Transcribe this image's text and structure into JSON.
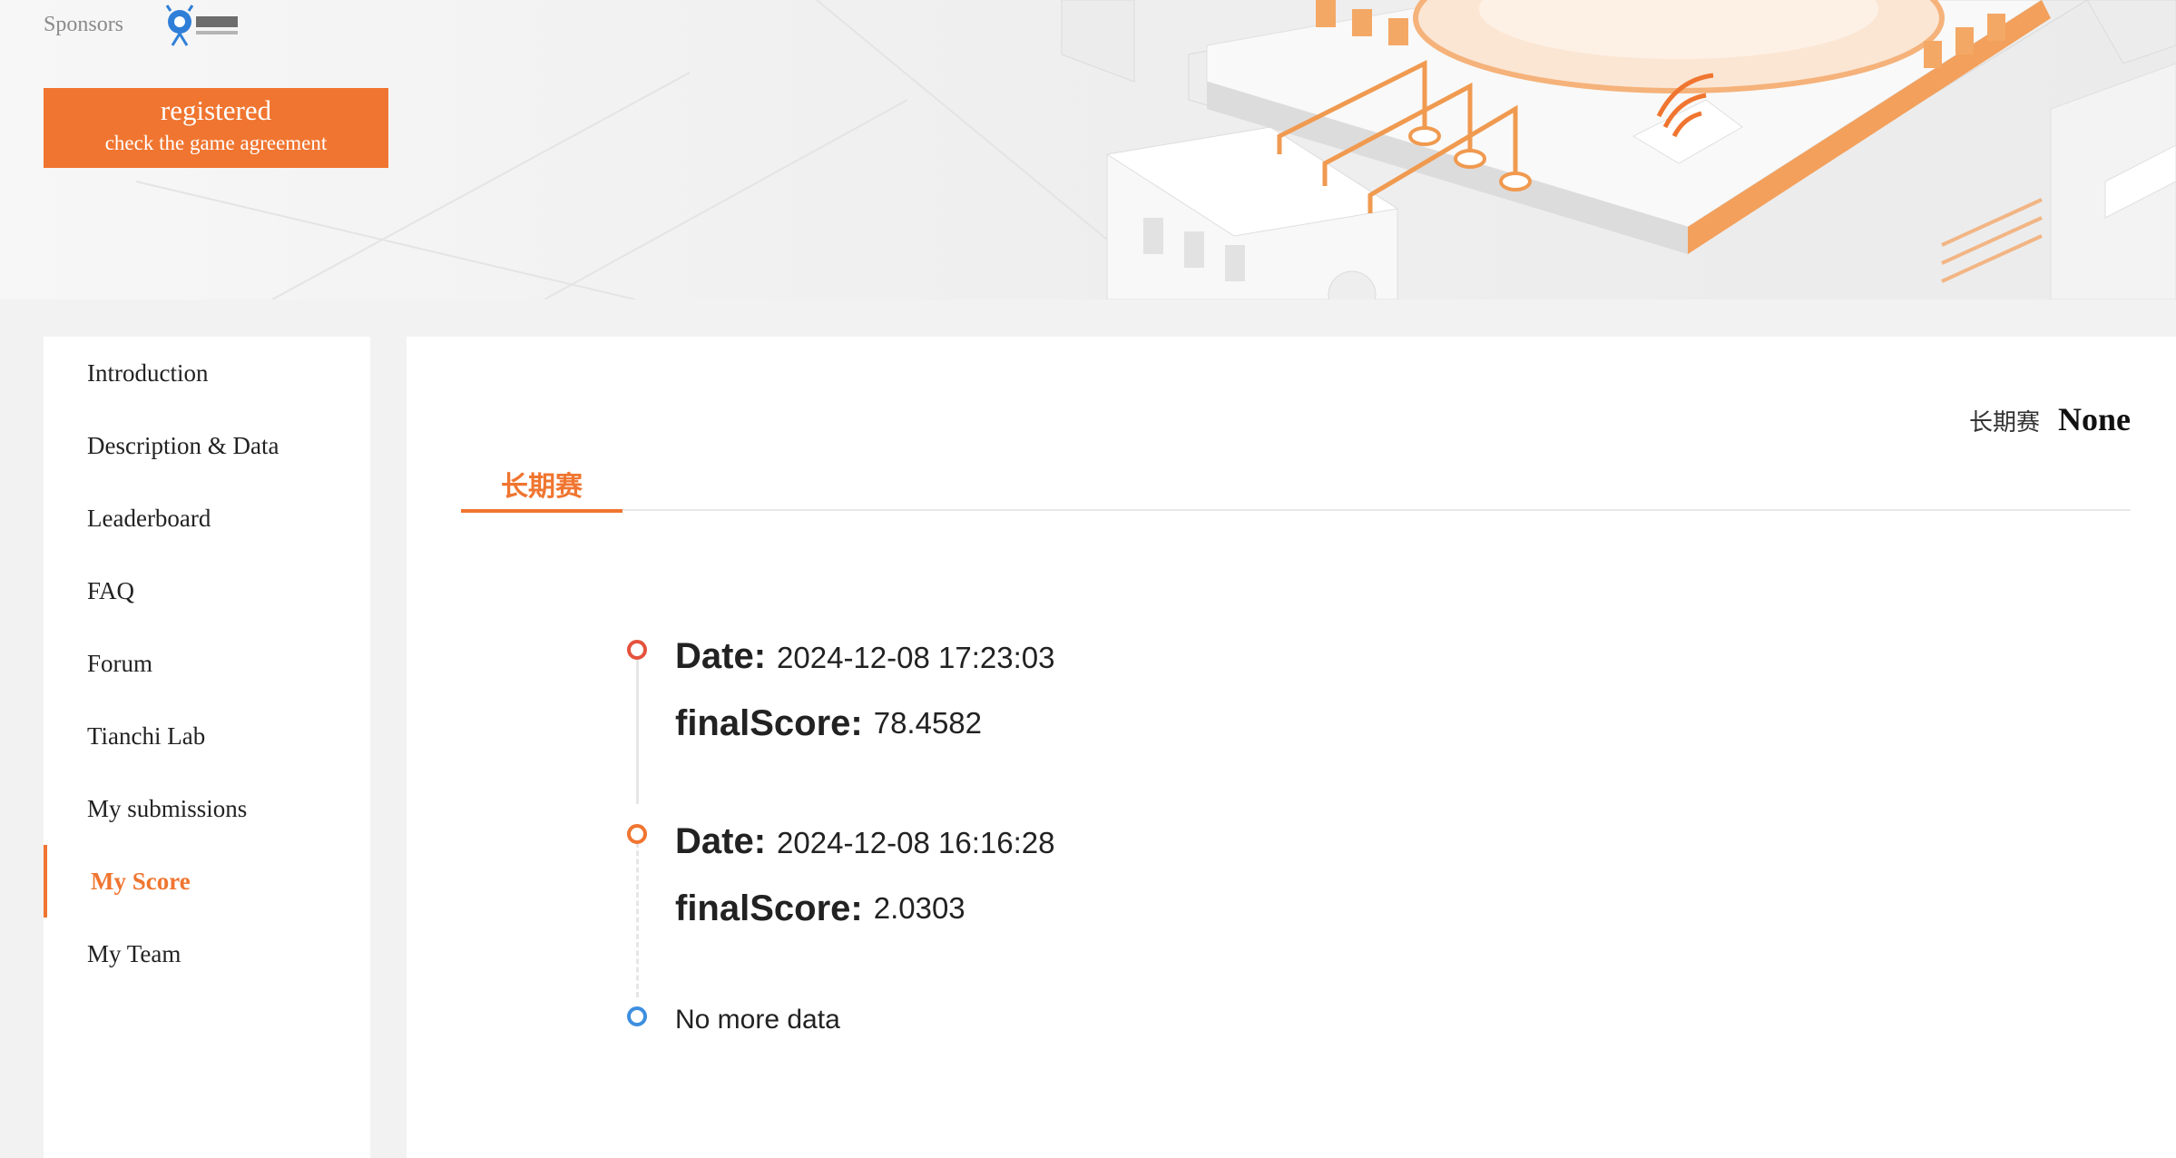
{
  "header": {
    "sponsors_label": "Sponsors",
    "sponsor_logo_text": "蚂蚁金服",
    "register_button": {
      "title": "registered",
      "subtitle": "check the game agreement"
    }
  },
  "sidebar": {
    "items": [
      {
        "label": "Introduction",
        "active": false
      },
      {
        "label": "Description & Data",
        "active": false
      },
      {
        "label": "Leaderboard",
        "active": false
      },
      {
        "label": "FAQ",
        "active": false
      },
      {
        "label": "Forum",
        "active": false
      },
      {
        "label": "Tianchi Lab",
        "active": false
      },
      {
        "label": "My submissions",
        "active": false
      },
      {
        "label": "My Score",
        "active": true
      },
      {
        "label": "My Team",
        "active": false
      }
    ]
  },
  "main": {
    "season_label": "长期赛",
    "season_value": "None",
    "tabs": [
      {
        "label": "长期赛",
        "active": true
      }
    ],
    "timeline": {
      "entries": [
        {
          "date_label": "Date:",
          "date": "2024-12-08 17:23:03",
          "score_label": "finalScore:",
          "score": "78.4582"
        },
        {
          "date_label": "Date:",
          "date": "2024-12-08 16:16:28",
          "score_label": "finalScore:",
          "score": "2.0303"
        }
      ],
      "end_text": "No more data"
    }
  },
  "colors": {
    "accent": "#f07530",
    "first_dot": "#e5533d",
    "second_dot": "#f07530",
    "end_dot": "#3d8fe0"
  }
}
